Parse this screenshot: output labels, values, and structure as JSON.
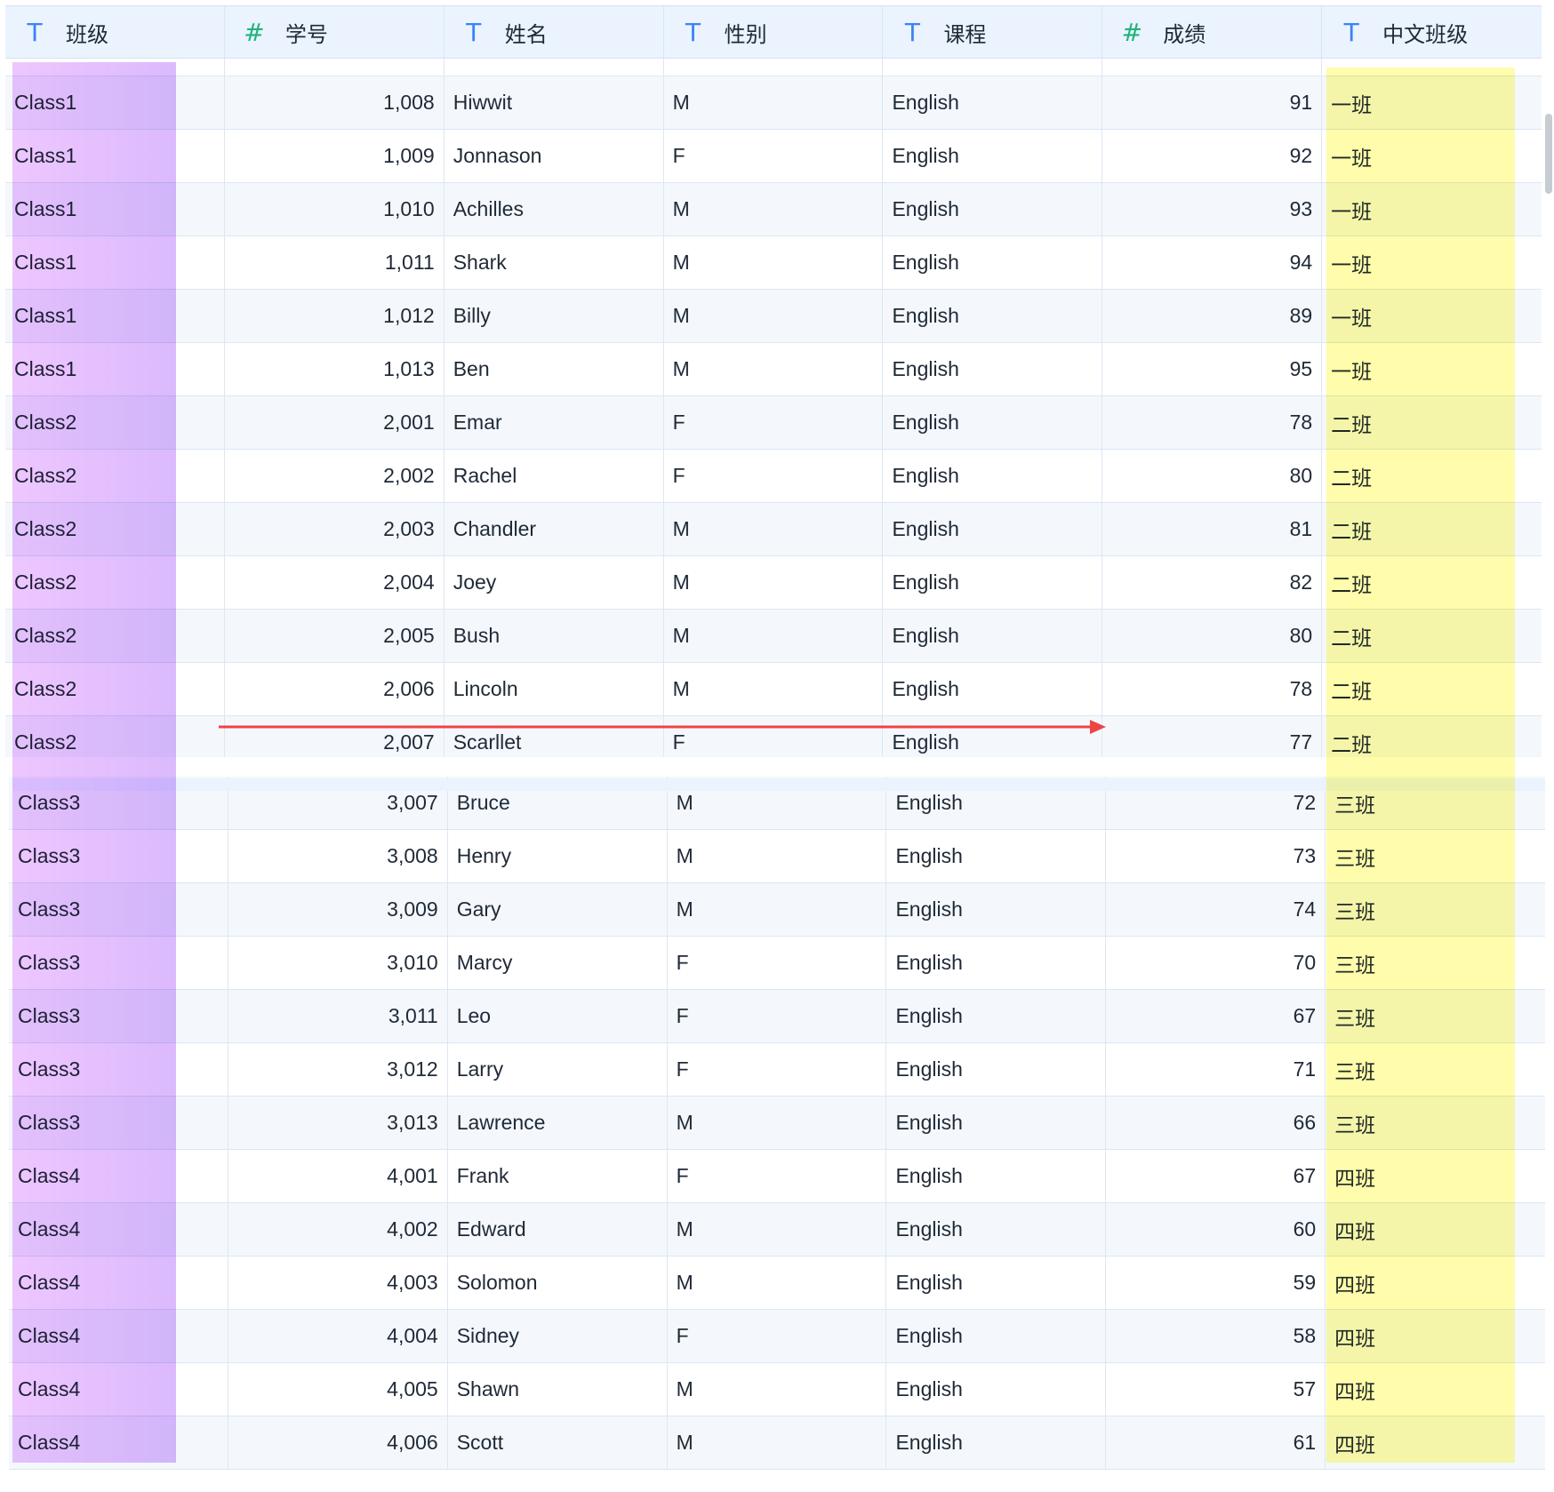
{
  "columns": [
    {
      "label": "班级",
      "type": "T"
    },
    {
      "label": "学号",
      "type": "#"
    },
    {
      "label": "姓名",
      "type": "T"
    },
    {
      "label": "性别",
      "type": "T"
    },
    {
      "label": "课程",
      "type": "T"
    },
    {
      "label": "成绩",
      "type": "#"
    },
    {
      "label": "中文班级",
      "type": "T"
    }
  ],
  "rows_top": [
    [
      "Class1",
      "1,008",
      "Hiwwit",
      "M",
      "English",
      "91",
      "一班"
    ],
    [
      "Class1",
      "1,009",
      "Jonnason",
      "F",
      "English",
      "92",
      "一班"
    ],
    [
      "Class1",
      "1,010",
      "Achilles",
      "M",
      "English",
      "93",
      "一班"
    ],
    [
      "Class1",
      "1,011",
      "Shark",
      "M",
      "English",
      "94",
      "一班"
    ],
    [
      "Class1",
      "1,012",
      "Billy",
      "M",
      "English",
      "89",
      "一班"
    ],
    [
      "Class1",
      "1,013",
      "Ben",
      "M",
      "English",
      "95",
      "一班"
    ],
    [
      "Class2",
      "2,001",
      "Emar",
      "F",
      "English",
      "78",
      "二班"
    ],
    [
      "Class2",
      "2,002",
      "Rachel",
      "F",
      "English",
      "80",
      "二班"
    ],
    [
      "Class2",
      "2,003",
      "Chandler",
      "M",
      "English",
      "81",
      "二班"
    ],
    [
      "Class2",
      "2,004",
      "Joey",
      "M",
      "English",
      "82",
      "二班"
    ],
    [
      "Class2",
      "2,005",
      "Bush",
      "M",
      "English",
      "80",
      "二班"
    ],
    [
      "Class2",
      "2,006",
      "Lincoln",
      "M",
      "English",
      "78",
      "二班"
    ],
    [
      "Class2",
      "2,007",
      "Scarllet",
      "F",
      "English",
      "77",
      "二班"
    ]
  ],
  "rows_bottom": [
    [
      "Class3",
      "3,007",
      "Bruce",
      "M",
      "English",
      "72",
      "三班"
    ],
    [
      "Class3",
      "3,008",
      "Henry",
      "M",
      "English",
      "73",
      "三班"
    ],
    [
      "Class3",
      "3,009",
      "Gary",
      "M",
      "English",
      "74",
      "三班"
    ],
    [
      "Class3",
      "3,010",
      "Marcy",
      "F",
      "English",
      "70",
      "三班"
    ],
    [
      "Class3",
      "3,011",
      "Leo",
      "F",
      "English",
      "67",
      "三班"
    ],
    [
      "Class3",
      "3,012",
      "Larry",
      "F",
      "English",
      "71",
      "三班"
    ],
    [
      "Class3",
      "3,013",
      "Lawrence",
      "M",
      "English",
      "66",
      "三班"
    ],
    [
      "Class4",
      "4,001",
      "Frank",
      "F",
      "English",
      "67",
      "四班"
    ],
    [
      "Class4",
      "4,002",
      "Edward",
      "M",
      "English",
      "60",
      "四班"
    ],
    [
      "Class4",
      "4,003",
      "Solomon",
      "M",
      "English",
      "59",
      "四班"
    ],
    [
      "Class4",
      "4,004",
      "Sidney",
      "F",
      "English",
      "58",
      "四班"
    ],
    [
      "Class4",
      "4,005",
      "Shawn",
      "M",
      "English",
      "57",
      "四班"
    ],
    [
      "Class4",
      "4,006",
      "Scott",
      "M",
      "English",
      "61",
      "四班"
    ]
  ],
  "numeric_columns": [
    1,
    5
  ],
  "colors": {
    "header_bg": "#eaf3fe",
    "type_text_icon": "#3b82f6",
    "type_number_icon": "#21b37a",
    "highlight_purple": "#d678ff",
    "highlight_yellow": "#fffa78",
    "arrow": "#ef4444"
  },
  "icons": {
    "T": "text-type-icon",
    "#": "number-type-icon"
  }
}
